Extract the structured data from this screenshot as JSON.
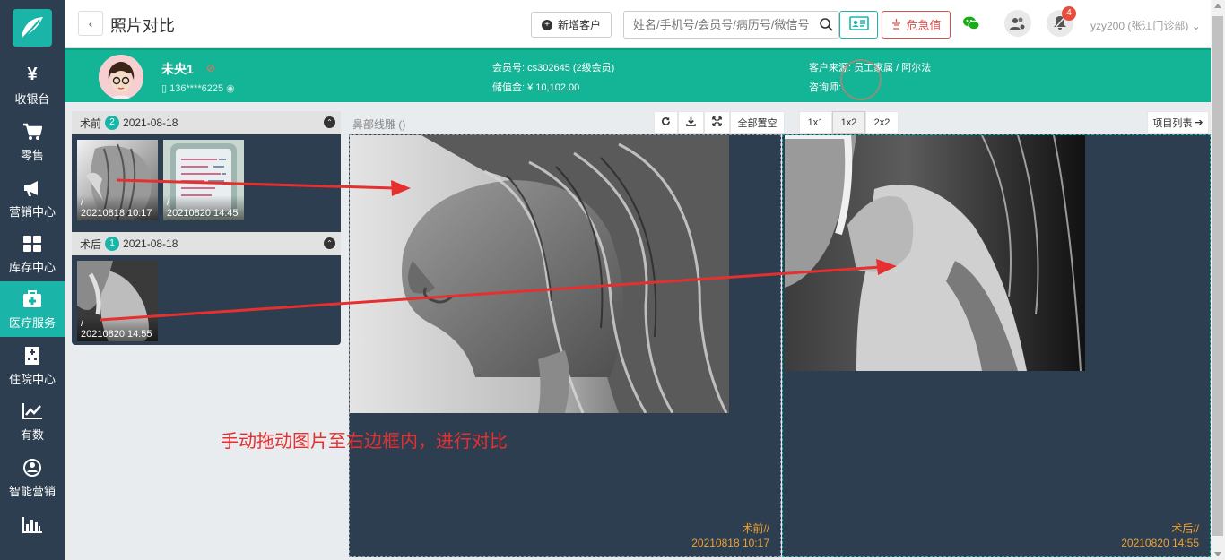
{
  "sidebar": {
    "items": [
      {
        "label": "收银台",
        "icon": "yen-icon",
        "glyph": "¥"
      },
      {
        "label": "零售",
        "icon": "cart-icon"
      },
      {
        "label": "营销中心",
        "icon": "megaphone-icon"
      },
      {
        "label": "库存中心",
        "icon": "grid-icon"
      },
      {
        "label": "医疗服务",
        "icon": "medkit-icon",
        "active": true
      },
      {
        "label": "住院中心",
        "icon": "hospital-icon"
      },
      {
        "label": "有数",
        "icon": "line-chart-icon"
      },
      {
        "label": "智能营销",
        "icon": "smart-marketing-icon"
      },
      {
        "label": "",
        "icon": "bar-chart-icon"
      }
    ]
  },
  "header": {
    "back_glyph": "‹",
    "title": "照片对比",
    "new_customer": "新增客户",
    "search_placeholder": "姓名/手机号/会员号/病历号/微信号",
    "critical_value": "危急值",
    "notification_count": "4",
    "user": "yzy200 (张江门诊部)"
  },
  "customer": {
    "name": "未央1",
    "phone": "136****6225",
    "member_label": "会员号:",
    "member_no": "cs302645 (2级会员)",
    "balance_label": "储值金:",
    "balance": "¥ 10,102.00",
    "source_label": "客户来源:",
    "source": "员工家属 / 阿尔法",
    "advisor_label": "咨询师:",
    "advisor": ""
  },
  "groups": [
    {
      "label": "术前",
      "count": "2",
      "date": "2021-08-18",
      "toggle": "⌃",
      "photos": [
        {
          "caption": "/",
          "time": "20210818 10:17"
        },
        {
          "caption": "/",
          "time": "20210820 14:45"
        }
      ]
    },
    {
      "label": "术后",
      "count": "1",
      "date": "2021-08-18",
      "toggle": "⌃",
      "photos": [
        {
          "caption": "/",
          "time": "20210820 14:55"
        }
      ]
    }
  ],
  "compare": {
    "title": "鼻部线雕 ()",
    "clear_all": "全部置空",
    "layouts": [
      "1x1",
      "1x2",
      "2x2"
    ],
    "active_layout": "1x2",
    "project_list": "项目列表"
  },
  "frames": [
    {
      "label": "术前//",
      "time": "20210818 10:17"
    },
    {
      "label": "术后//",
      "time": "20210820 14:55"
    }
  ],
  "hint": "手动拖动图片至右边框内，进行对比",
  "colors": {
    "teal": "#1ab5a8",
    "banner": "#14b497",
    "sidebar": "#2c3e50",
    "danger": "#d9534f",
    "caption": "#f0a030",
    "annotation": "#e63030"
  }
}
